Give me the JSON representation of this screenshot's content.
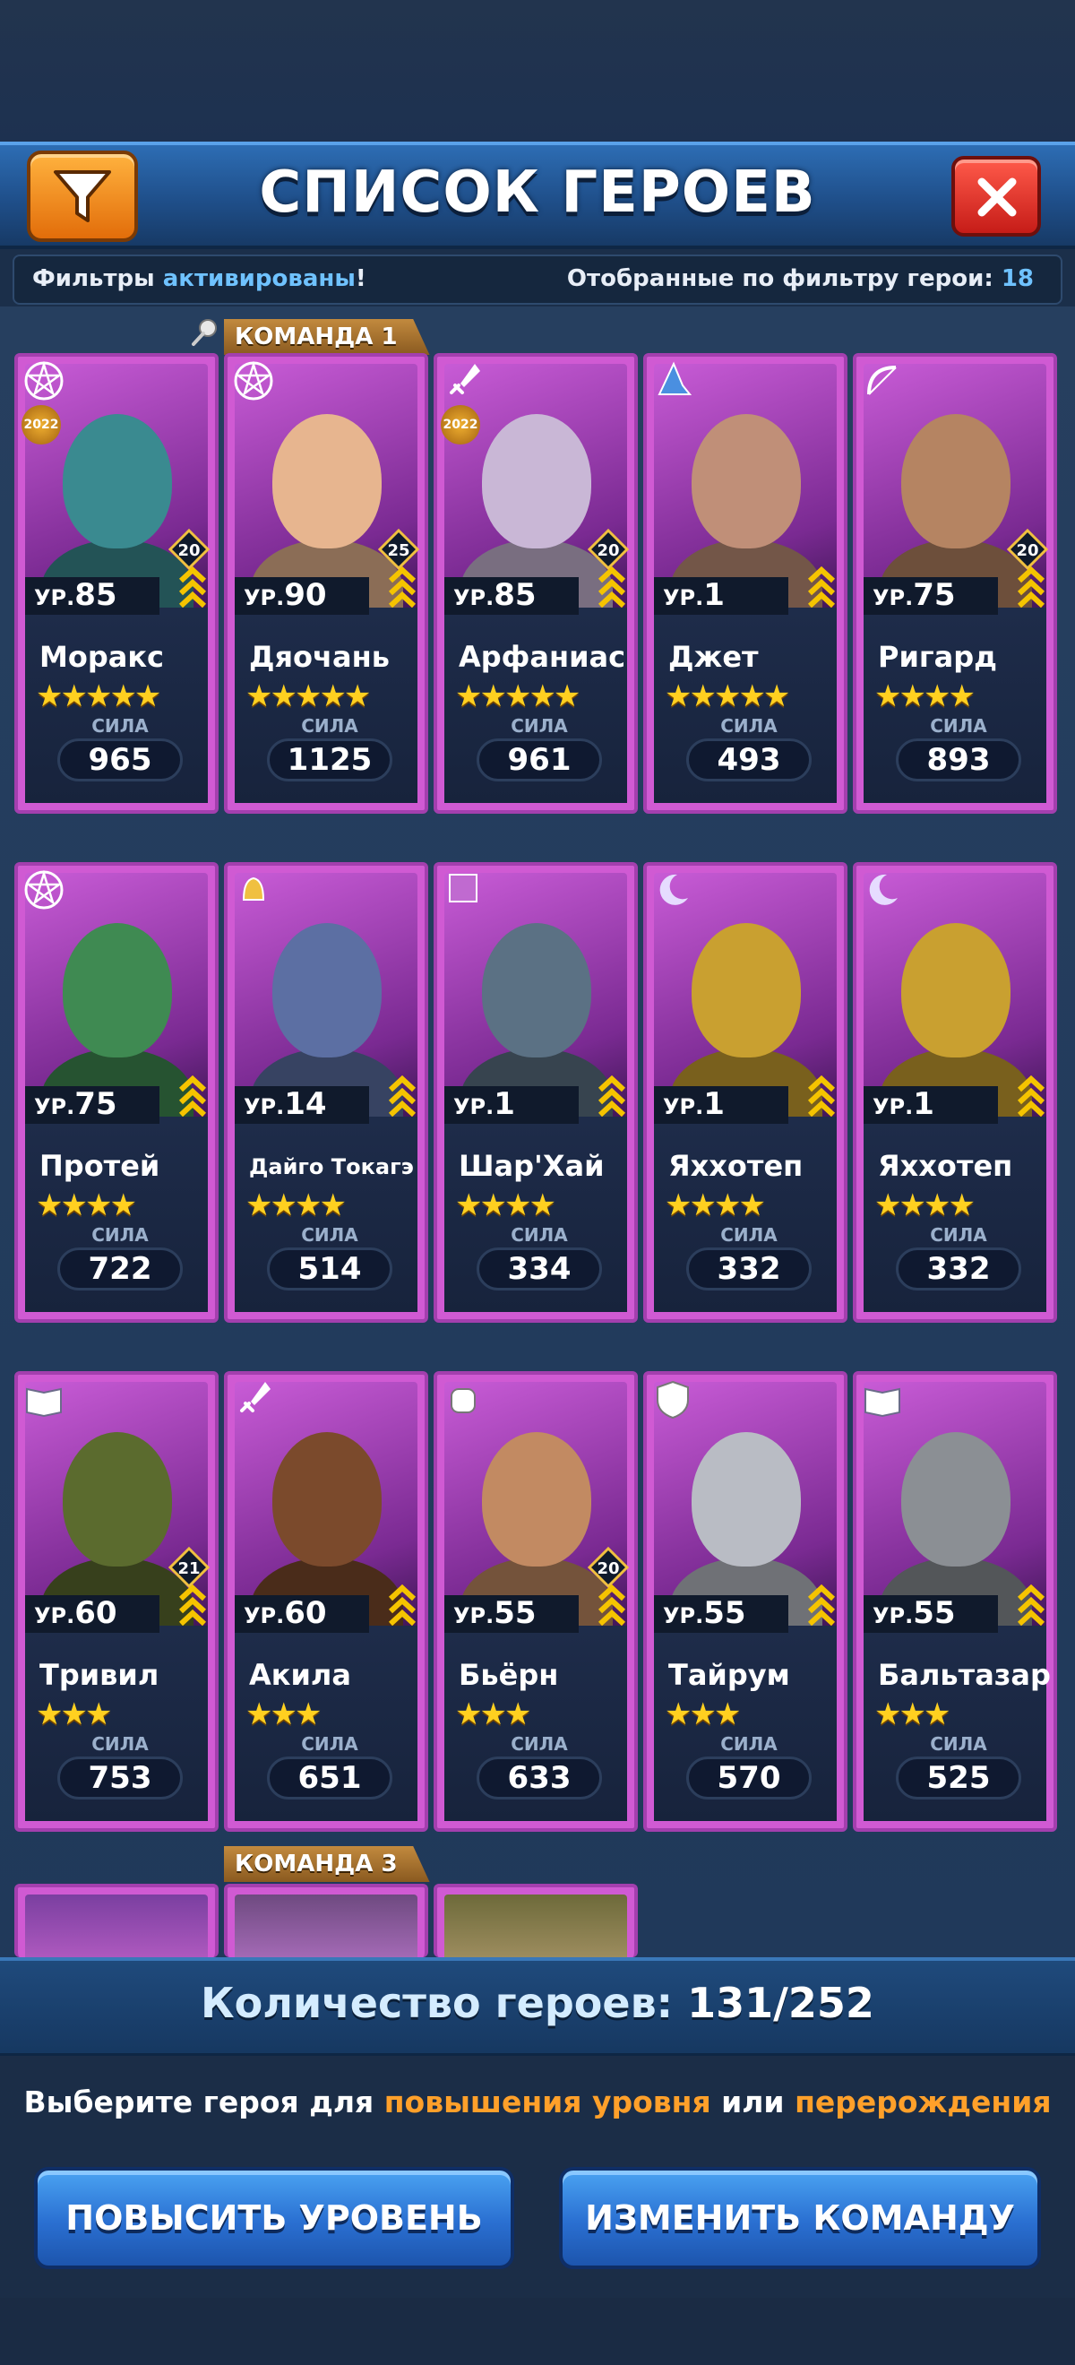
{
  "title": "СПИСОК ГЕРОЕВ",
  "filters": {
    "prefix": "Фильтры",
    "active": "активированы",
    "suffix": "!",
    "filtered_label": "Отобранные по фильтру герои:",
    "filtered_count": "18"
  },
  "teams": {
    "team1": "КОМАНДА 1",
    "team3": "КОМАНДА 3"
  },
  "level_prefix": "УР.",
  "power_label": "СИЛА",
  "heroes": [
    {
      "name": "Моракс",
      "level": "85",
      "stars": "★★★★★",
      "power": "965",
      "badge": "20",
      "tag": "2022",
      "class": "pentagram-icon",
      "color": "#3a8a90"
    },
    {
      "name": "Дяочань",
      "level": "90",
      "stars": "★★★★★",
      "power": "1125",
      "badge": "25",
      "tag": "",
      "class": "pentagram-icon",
      "color": "#e7b58f"
    },
    {
      "name": "Арфаниас",
      "level": "85",
      "stars": "★★★★★",
      "power": "961",
      "badge": "20",
      "tag": "2022",
      "class": "dagger-icon",
      "color": "#c9b7d6"
    },
    {
      "name": "Джет",
      "level": "1",
      "stars": "★★★★★",
      "power": "493",
      "badge": "",
      "tag": "",
      "class": "wizard-hat-icon",
      "color": "#c08f78"
    },
    {
      "name": "Ригард",
      "level": "75",
      "stars": "★★★★",
      "power": "893",
      "badge": "20",
      "tag": "",
      "class": "bow-icon",
      "color": "#b58462"
    },
    {
      "name": "Протей",
      "level": "75",
      "stars": "★★★★",
      "power": "722",
      "badge": "",
      "tag": "",
      "class": "pentagram-icon",
      "color": "#3f8a52"
    },
    {
      "name": "Дайго Токагэ",
      "level": "14",
      "stars": "★★★★",
      "power": "514",
      "badge": "",
      "tag": "",
      "class": "bell-icon",
      "color": "#5c6fa3"
    },
    {
      "name": "Шар'Хай",
      "level": "1",
      "stars": "★★★★",
      "power": "334",
      "badge": "",
      "tag": "",
      "class": "banner-icon",
      "color": "#5b7184"
    },
    {
      "name": "Яххотеп",
      "level": "1",
      "stars": "★★★★",
      "power": "332",
      "badge": "",
      "tag": "",
      "class": "moon-icon",
      "color": "#c9a030"
    },
    {
      "name": "Яххотеп",
      "level": "1",
      "stars": "★★★★",
      "power": "332",
      "badge": "",
      "tag": "",
      "class": "moon-icon",
      "color": "#c9a030"
    },
    {
      "name": "Тривил",
      "level": "60",
      "stars": "★★★",
      "power": "753",
      "badge": "21",
      "tag": "",
      "class": "book-icon",
      "color": "#5b6b2e"
    },
    {
      "name": "Акила",
      "level": "60",
      "stars": "★★★",
      "power": "651",
      "badge": "",
      "tag": "",
      "class": "dagger-icon",
      "color": "#7b4a2c"
    },
    {
      "name": "Бьёрн",
      "level": "55",
      "stars": "★★★",
      "power": "633",
      "badge": "20",
      "tag": "",
      "class": "fist-icon",
      "color": "#c28a62"
    },
    {
      "name": "Тайрум",
      "level": "55",
      "stars": "★★★",
      "power": "570",
      "badge": "",
      "tag": "",
      "class": "shield-icon",
      "color": "#b9bcc4"
    },
    {
      "name": "Бальтазар",
      "level": "55",
      "stars": "★★★",
      "power": "525",
      "badge": "",
      "tag": "",
      "class": "book-icon",
      "color": "#8b8f94"
    }
  ],
  "hero_count": {
    "label": "Количество героев:",
    "value": "131/252"
  },
  "hint": {
    "part1": "Выберите героя для",
    "part2": "повышения уровня",
    "part3": "или",
    "part4": "перерождения"
  },
  "buttons": {
    "level_up": "ПОВЫСИТЬ УРОВЕНЬ",
    "change_team": "ИЗМЕНИТЬ КОМАНДУ"
  },
  "colors": {
    "card_border": "#d05ad3",
    "accent_orange": "#ffa02a",
    "highlight_blue": "#6fc2ff",
    "button_blue": "#2a6fd1"
  }
}
